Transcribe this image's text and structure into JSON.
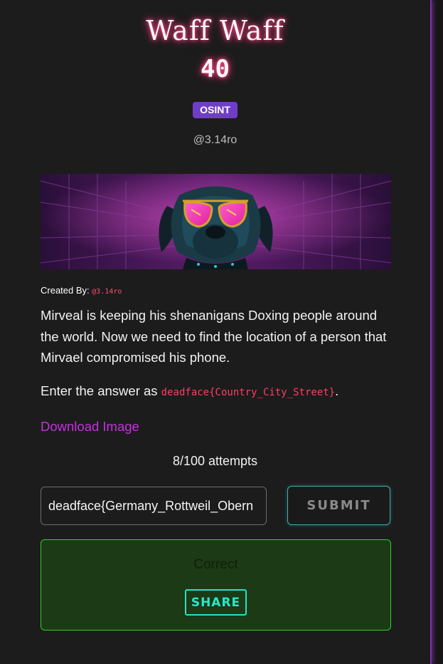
{
  "challenge": {
    "title": "Waff Waff",
    "points": "40",
    "category": "OSINT",
    "author": "@3.14ro"
  },
  "created_by": {
    "label": "Created By:",
    "handle": "@3.14ro"
  },
  "description": {
    "body": "Mirveal is keeping his shenanigans Doxing people around the world. Now we need to find the location of a person that Mirvael compromised his phone.",
    "answer_prefix": "Enter the answer as ",
    "answer_format": "deadface{Country_City_Street}",
    "answer_suffix": "."
  },
  "download_link": "Download Image",
  "attempts": "8/100 attempts",
  "form": {
    "flag_value": "deadface{Germany_Rottweil_Obern",
    "submit_label": "SUBMIT"
  },
  "result": {
    "message": "Correct",
    "share_label": "SHARE"
  },
  "colors": {
    "category_badge": "#6f3ec7",
    "link": "#c531e0",
    "success_border": "#2ed12a",
    "share_accent": "#29e0c8",
    "panel_edge": "#7a2fa8"
  }
}
